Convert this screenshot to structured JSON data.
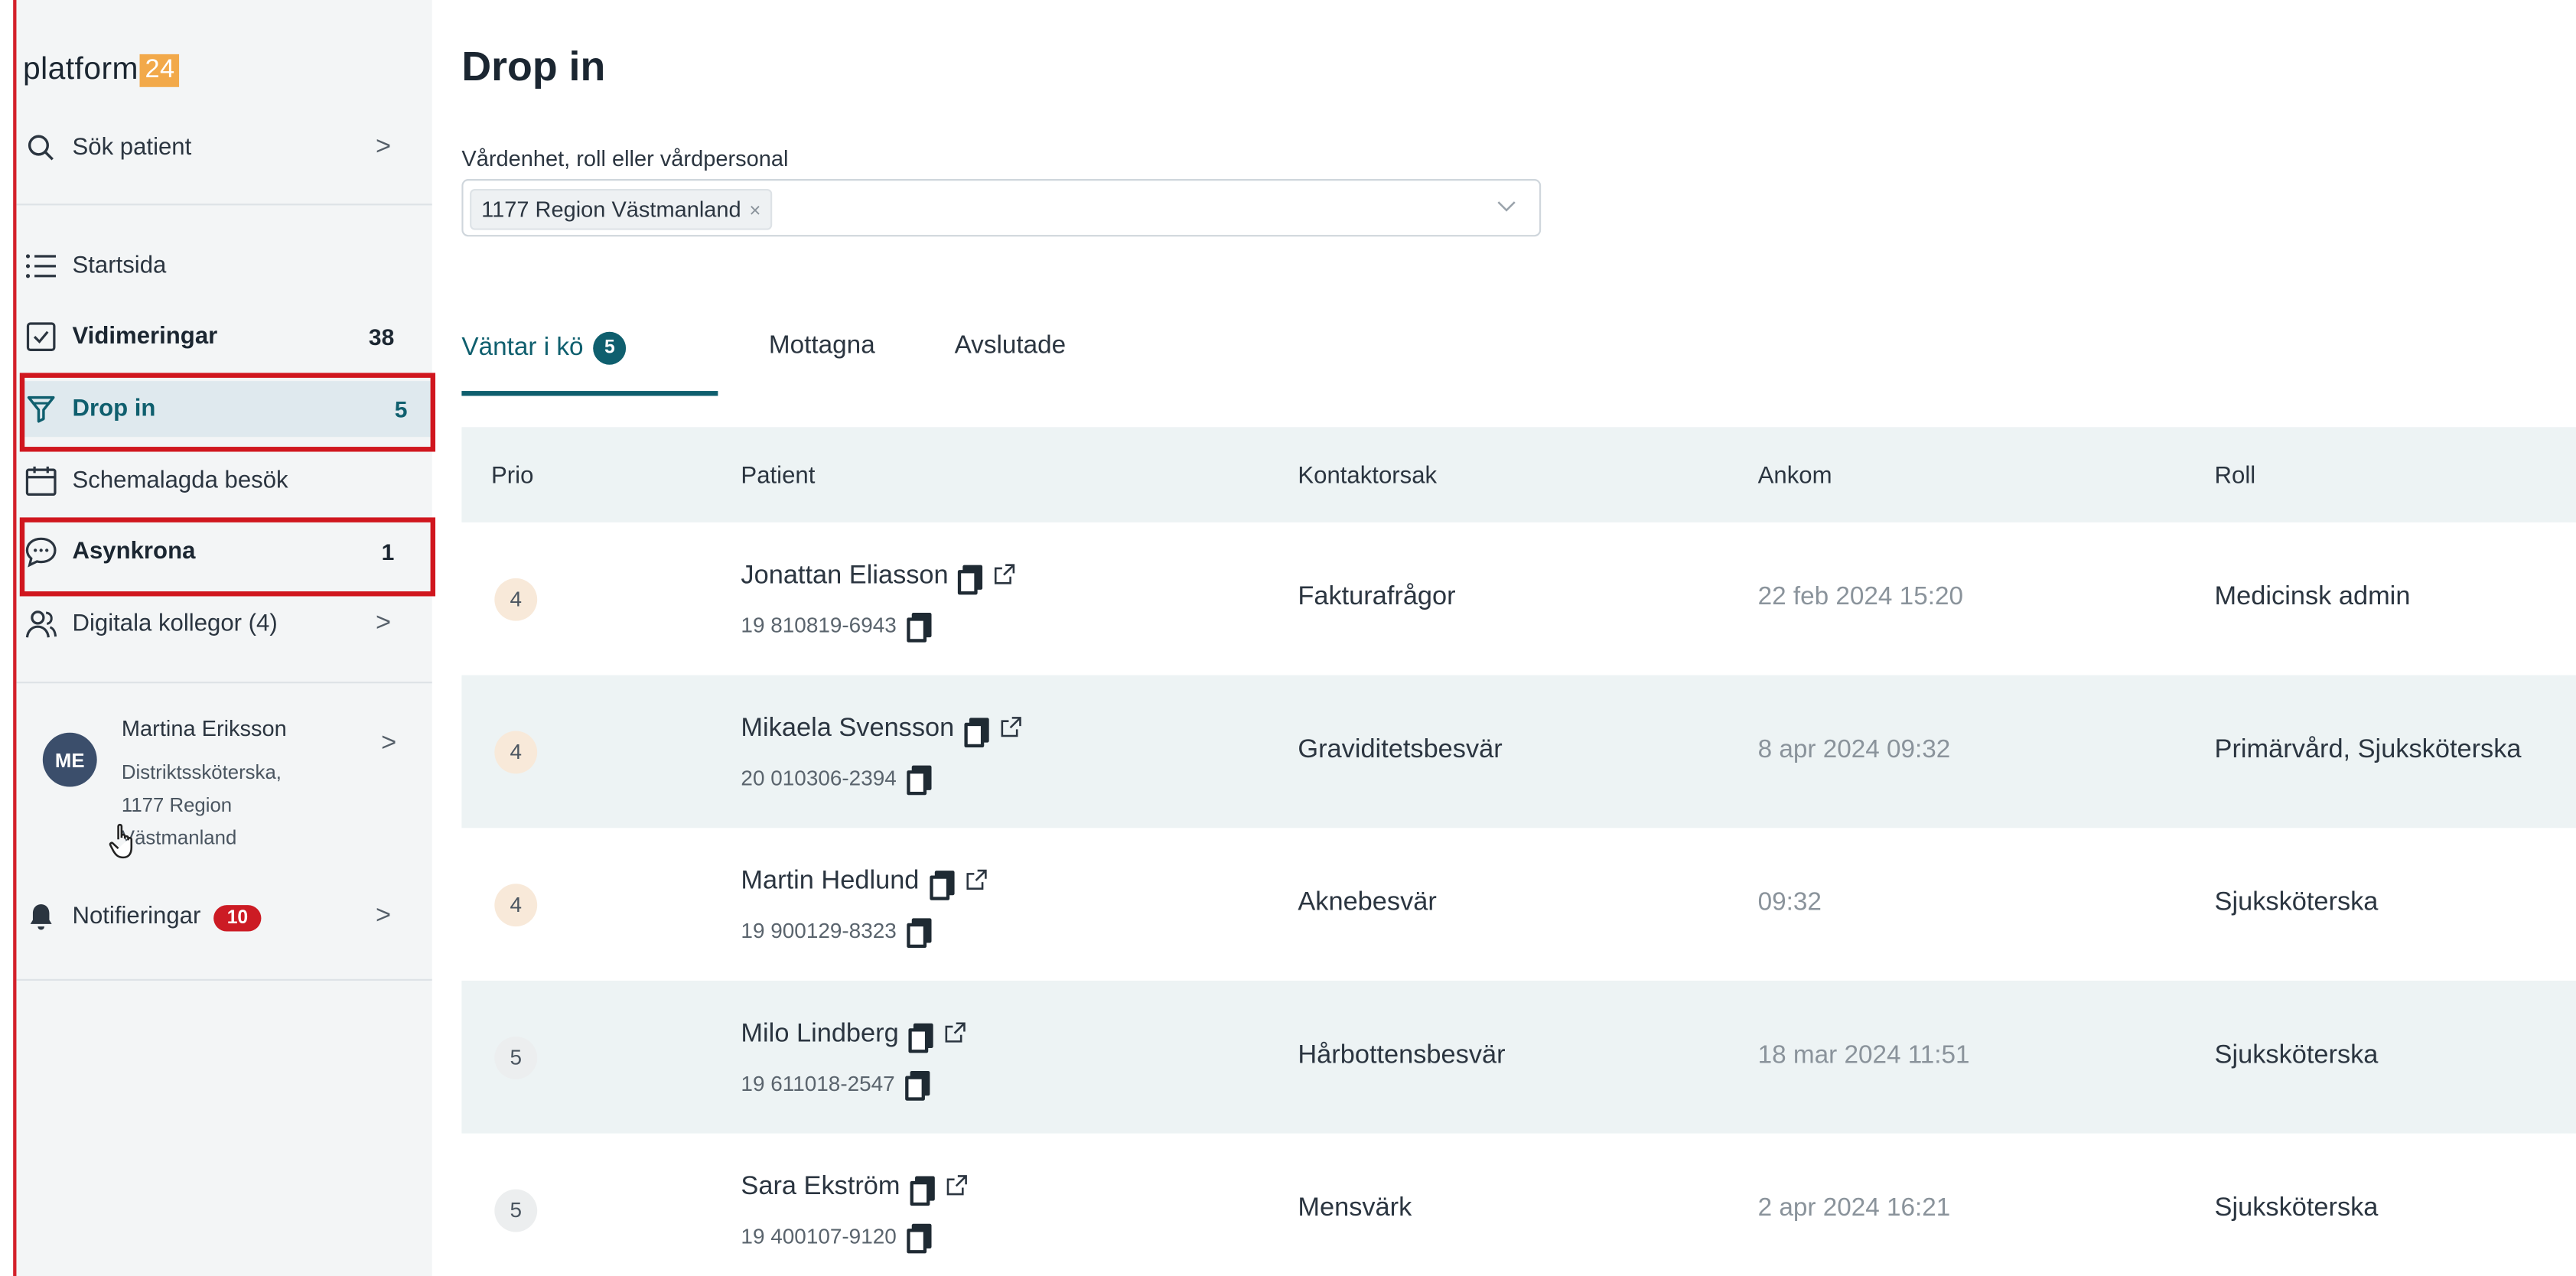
{
  "logo": {
    "text": "platform",
    "number": "24"
  },
  "sidebar": {
    "search_label": "Sök patient",
    "items": [
      {
        "label": "Startsida",
        "count": ""
      },
      {
        "label": "Vidimeringar",
        "count": "38"
      },
      {
        "label": "Drop in",
        "count": "5"
      },
      {
        "label": "Schemalagda besök",
        "count": ""
      },
      {
        "label": "Asynkrona",
        "count": "1"
      },
      {
        "label": "Digitala kollegor (4)",
        "count": ""
      }
    ],
    "user": {
      "initials": "ME",
      "name": "Martina Eriksson",
      "role_line1": "Distriktssköterska,",
      "role_line2": "1177 Region",
      "role_line3": "Västmanland"
    },
    "notifications": {
      "label": "Notifieringar",
      "count": "10"
    }
  },
  "main": {
    "title": "Drop in",
    "filter_label": "Vårdenhet, roll eller vårdpersonal",
    "filter_chip": "1177 Region Västmanland",
    "tabs": [
      {
        "label": "Väntar i kö",
        "count": "5"
      },
      {
        "label": "Mottagna"
      },
      {
        "label": "Avslutade"
      }
    ],
    "table": {
      "headers": {
        "prio": "Prio",
        "patient": "Patient",
        "reason": "Kontaktorsak",
        "arrived": "Ankom",
        "role": "Roll"
      },
      "rows": [
        {
          "prio": "4",
          "name": "Jonattan Eliasson",
          "id": "19 810819-6943",
          "reason": "Fakturafrågor",
          "arrived": "22 feb 2024 15:20",
          "role": "Medicinsk admin"
        },
        {
          "prio": "4",
          "name": "Mikaela Svensson",
          "id": "20 010306-2394",
          "reason": "Graviditetsbesvär",
          "arrived": "8 apr 2024 09:32",
          "role": "Primärvård, Sjuksköterska"
        },
        {
          "prio": "4",
          "name": "Martin Hedlund",
          "id": "19 900129-8323",
          "reason": "Aknebesvär",
          "arrived": "09:32",
          "role": "Sjuksköterska"
        },
        {
          "prio": "5",
          "name": "Milo Lindberg",
          "id": "19 611018-2547",
          "reason": "Hårbottensbesvär",
          "arrived": "18 mar 2024 11:51",
          "role": "Sjuksköterska"
        },
        {
          "prio": "5",
          "name": "Sara Ekström",
          "id": "19 400107-9120",
          "reason": "Mensvärk",
          "arrived": "2 apr 2024 16:21",
          "role": "Sjuksköterska"
        }
      ]
    }
  }
}
